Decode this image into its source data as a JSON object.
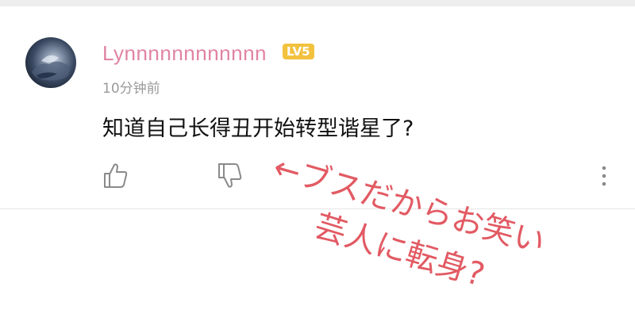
{
  "comment": {
    "username": "Lynnnnnnnnnnnn",
    "level_badge": "LV5",
    "timestamp": "10分钟前",
    "text": "知道自己长得丑开始转型谐星了?",
    "actions": {
      "like_icon": "thumbs-up-icon",
      "dislike_icon": "thumbs-down-icon",
      "more_icon": "more-vertical-icon"
    }
  },
  "annotation": {
    "line1": "←ブスだからお笑い",
    "line2": "芸人に転身?",
    "color": "#e25a63"
  },
  "colors": {
    "username": "#e084a3",
    "badge": "#f2c13e",
    "timestamp": "#9a9a9a",
    "text": "#111111"
  }
}
